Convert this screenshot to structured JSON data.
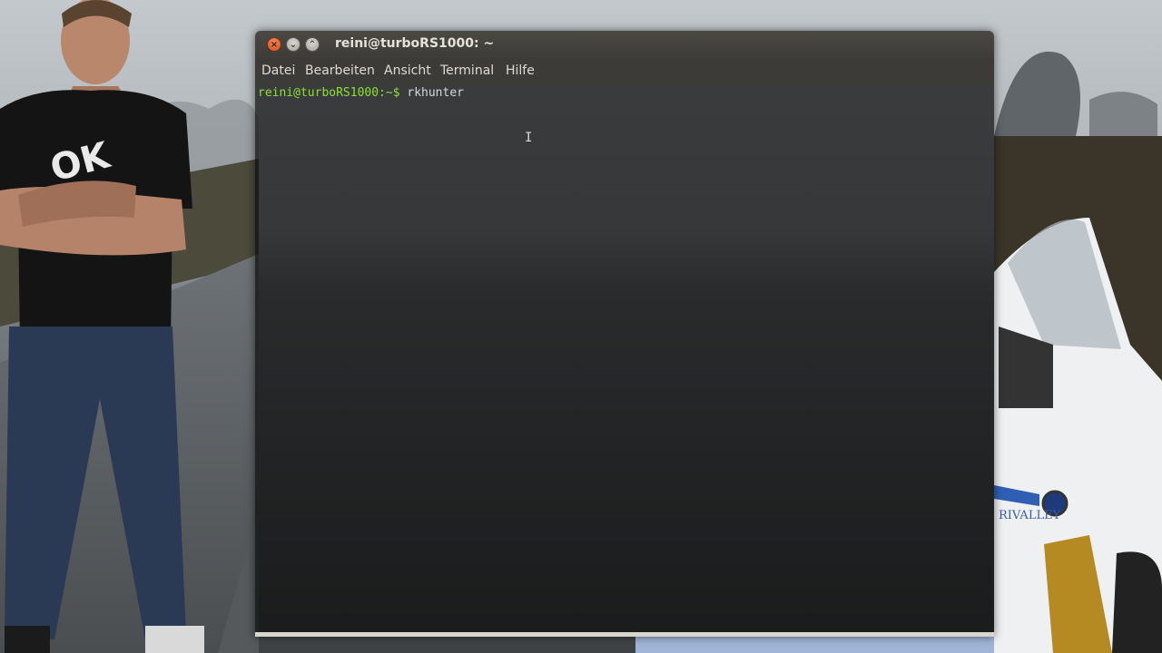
{
  "window": {
    "title": "reini@turboRS1000: ~",
    "controls": {
      "close": "close-icon",
      "minimize": "minimize-icon",
      "maximize": "maximize-icon"
    }
  },
  "menubar": {
    "items": [
      "Datei",
      "Bearbeiten",
      "Ansicht",
      "Terminal",
      "Hilfe"
    ]
  },
  "terminal": {
    "prompt": "reini@turboRS1000:~$",
    "command": " rkhunter"
  },
  "colors": {
    "prompt": "#8ae234",
    "titlebar": "#3c3b37",
    "close_button": "#e05a2a"
  },
  "wallpaper": {
    "sign": "RIVALLEY"
  }
}
